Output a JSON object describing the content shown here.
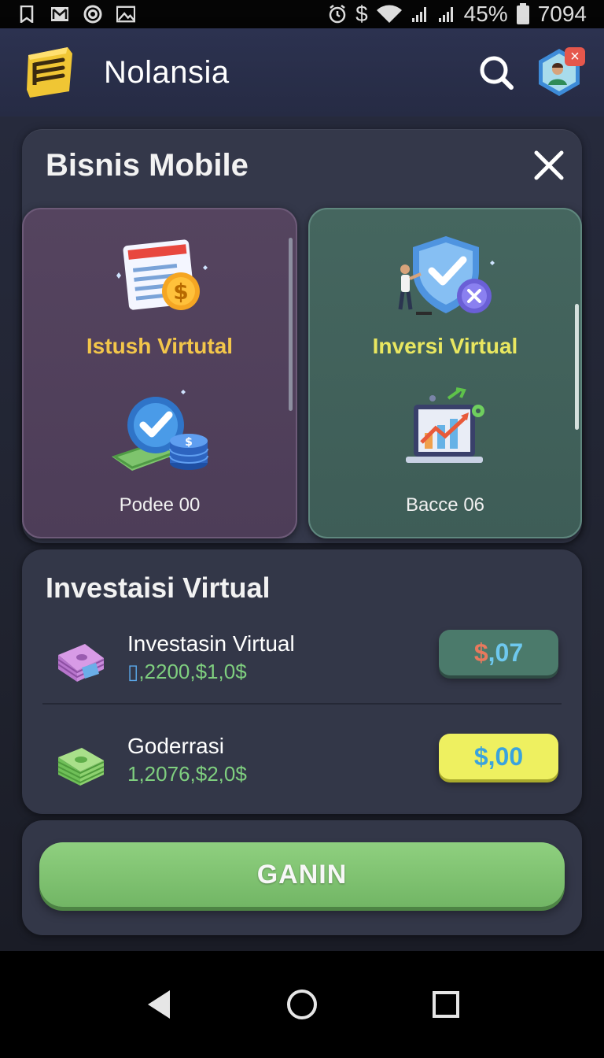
{
  "status_bar": {
    "left_icons": [
      "bookmark-icon",
      "mail-icon",
      "target-icon",
      "image-icon"
    ],
    "alarm_icon": "alarm-icon",
    "currency_symbol": "$",
    "wifi_icon": "wifi-icon",
    "signal_icons": [
      "signal-icon",
      "signal-icon"
    ],
    "battery_percent": "45%",
    "battery_icon": "battery-icon",
    "time": "7094"
  },
  "app_bar": {
    "title": "Nolansia",
    "logo_icon": "book-logo-icon",
    "search_icon": "search-icon",
    "avatar_icon": "profile-avatar-icon",
    "notification_badge": "×"
  },
  "business_panel": {
    "title": "Bisnis Mobile",
    "close_icon": "close-icon",
    "cards": [
      {
        "label": "Istush Virtutal",
        "label_color": "#f3c64a",
        "top_icon": "document-coin-icon",
        "bottom_icon": "check-coins-cash-icon",
        "sub": "Podee 00"
      },
      {
        "label": "Inversi Virtual",
        "label_color": "#e9e760",
        "top_icon": "shield-person-icon",
        "bottom_icon": "laptop-chart-icon",
        "sub": "Bacce 06"
      }
    ]
  },
  "investment_panel": {
    "title": "Investaisi Virtual",
    "rows": [
      {
        "icon": "purple-cash-stack-icon",
        "name": "Investasin Virtual",
        "value_prefix": "▯",
        "value": ",2200,$1,0$",
        "button_dollar": "$",
        "button_value": ",07",
        "button_dollar_color": "#e9795d",
        "button_value_color": "#6ec8ee"
      },
      {
        "icon": "green-cash-stack-icon",
        "name": "Goderrasi",
        "value_prefix": "",
        "value": "1,2076,$2,0$",
        "button_dollar": "$",
        "button_value": ",00",
        "button_dollar_color": "#3aa3dd",
        "button_value_color": "#3aa3dd"
      }
    ]
  },
  "cta": {
    "label": "GANIN"
  },
  "nav_bar": {
    "back_icon": "back-icon",
    "home_icon": "home-icon",
    "recents_icon": "recents-icon"
  }
}
